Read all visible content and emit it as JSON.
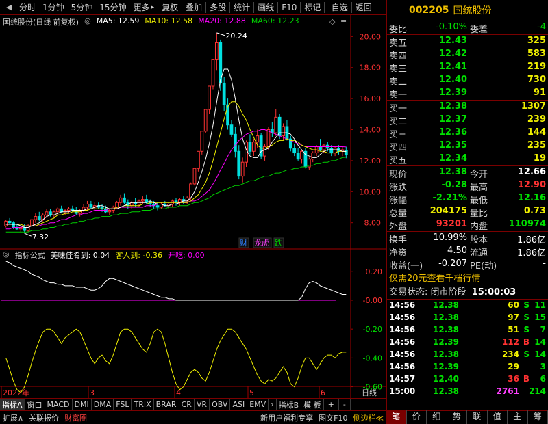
{
  "colors": {
    "up": "#ff3232",
    "down": "#00e0e0",
    "green": "#00d000",
    "white": "#ffffff",
    "ma5": "#ffffff",
    "ma10": "#f0f000",
    "ma20": "#ff00ff",
    "ma60": "#00cc00",
    "axis": "#a00000",
    "gold": "#f0c000"
  },
  "toolbar": {
    "items": [
      "分时",
      "1分钟",
      "5分钟",
      "15分钟",
      "更多",
      "复权",
      "叠加",
      "多股",
      "统计",
      "画线",
      "F10",
      "标记",
      "-自选",
      "返回"
    ],
    "more_arrow": "▸"
  },
  "chart": {
    "stock_label": "国统股份(日线 前复权)",
    "ma_toggle": "◎",
    "ma": [
      {
        "label": "MA5: 12.59",
        "color": "#ffffff"
      },
      {
        "label": "MA10: 12.58",
        "color": "#f0f000"
      },
      {
        "label": "MA20: 12.88",
        "color": "#ff00ff"
      },
      {
        "label": "MA60: 12.23",
        "color": "#00cc00"
      }
    ],
    "price_axis": [
      "20.00",
      "18.00",
      "16.00",
      "14.00",
      "12.00",
      "10.00",
      "8.00"
    ],
    "price_range": [
      6.4,
      20.5
    ],
    "high_label": "20.24",
    "low_label": "7.32",
    "markers": [
      {
        "text": "财",
        "color": "#3080ff"
      },
      {
        "text": "龙虎",
        "color": "#ff40ff"
      },
      {
        "text": "跌",
        "color": "#00d000"
      }
    ],
    "icons": [
      "diamond-icon",
      "menu-icon"
    ]
  },
  "indicator": {
    "name": "指标公式",
    "values": [
      {
        "label": "美味佳肴到: 0.04",
        "color": "#ffffff"
      },
      {
        "label": "客人到: -0.36",
        "color": "#f0f000"
      },
      {
        "label": "开吃: 0.00",
        "color": "#ff00ff"
      }
    ],
    "axis": [
      "0.20",
      "-0.00",
      "-0.20",
      "-0.40",
      "-0.60"
    ],
    "range": [
      -0.64,
      0.27
    ]
  },
  "x_axis": {
    "labels": [
      "2022年",
      "3",
      "4",
      "5",
      "6"
    ],
    "corner": "日线"
  },
  "indicator_tabs": [
    "指标A",
    "窗口",
    "MACD",
    "DMI",
    "DMA",
    "FSL",
    "TRIX",
    "BRAR",
    "CR",
    "VR",
    "OBV",
    "ASI",
    "EMV",
    "指标B",
    "模 板",
    "+",
    "-"
  ],
  "nav_arrow": "›",
  "status_bar": [
    {
      "text": "扩展∧",
      "color": "#d0d0d0"
    },
    {
      "text": "关联报价",
      "color": "#d0d0d0"
    },
    {
      "text": "财富圈",
      "color": "#ff4040"
    }
  ],
  "status_right": [
    {
      "text": "新用户福利专享",
      "color": "#d0d0d0"
    },
    {
      "text": "图文F10",
      "color": "#d0d0d0"
    },
    {
      "text": "侧边栏≪",
      "color": "#f0c000"
    }
  ],
  "quote": {
    "code": "002205",
    "name": "国统股份",
    "weibi_label": "委比",
    "weibi_value": "-0.10%",
    "weicha_label": "委差",
    "weicha_value": "-4",
    "asks": [
      {
        "label": "卖五",
        "price": "12.43",
        "vol": "325"
      },
      {
        "label": "卖四",
        "price": "12.42",
        "vol": "583"
      },
      {
        "label": "卖三",
        "price": "12.41",
        "vol": "219"
      },
      {
        "label": "卖二",
        "price": "12.40",
        "vol": "730"
      },
      {
        "label": "卖一",
        "price": "12.39",
        "vol": "91"
      }
    ],
    "bids": [
      {
        "label": "买一",
        "price": "12.38",
        "vol": "1307"
      },
      {
        "label": "买二",
        "price": "12.37",
        "vol": "239"
      },
      {
        "label": "买三",
        "price": "12.36",
        "vol": "144"
      },
      {
        "label": "买四",
        "price": "12.35",
        "vol": "235"
      },
      {
        "label": "买五",
        "price": "12.34",
        "vol": "19"
      }
    ],
    "stats": [
      {
        "l1": "现价",
        "v1": "12.38",
        "c1": "#00e000",
        "l2": "今开",
        "v2": "12.66",
        "c2": "#ffffff"
      },
      {
        "l1": "涨跌",
        "v1": "-0.28",
        "c1": "#00e000",
        "l2": "最高",
        "v2": "12.90",
        "c2": "#ff3232"
      },
      {
        "l1": "涨幅",
        "v1": "-2.21%",
        "c1": "#00e000",
        "l2": "最低",
        "v2": "12.16",
        "c2": "#00e000"
      },
      {
        "l1": "总量",
        "v1": "204175",
        "c1": "#f0f000",
        "l2": "量比",
        "v2": "0.73",
        "c2": "#f0f000"
      },
      {
        "l1": "外盘",
        "v1": "93201",
        "c1": "#ff3232",
        "l2": "内盘",
        "v2": "110974",
        "c2": "#00e000"
      }
    ],
    "stats2": [
      {
        "l1": "换手",
        "v1": "10.99%",
        "l2": "股本",
        "v2": "1.86亿"
      },
      {
        "l1": "净资",
        "v1": "4.50",
        "l2": "流通",
        "v2": "1.86亿"
      },
      {
        "l1": "收益(一)",
        "v1": "-0.207",
        "l2": "PE(动)",
        "v2": "-"
      }
    ],
    "promo": "仅需20元查看千档行情",
    "trade_state_label": "交易状态: 闭市阶段",
    "trade_state_time": "15:00:03",
    "ticks": [
      {
        "time": "14:56",
        "price": "12.38",
        "vol": "60",
        "side": "S",
        "n": "11"
      },
      {
        "time": "14:56",
        "price": "12.38",
        "vol": "97",
        "side": "S",
        "n": "15"
      },
      {
        "time": "14:56",
        "price": "12.38",
        "vol": "51",
        "side": "S",
        "n": "7"
      },
      {
        "time": "14:56",
        "price": "12.39",
        "vol": "112",
        "side": "B",
        "n": "14"
      },
      {
        "time": "14:56",
        "price": "12.38",
        "vol": "234",
        "side": "S",
        "n": "14"
      },
      {
        "time": "14:56",
        "price": "12.39",
        "vol": "29",
        "side": "",
        "n": "3"
      },
      {
        "time": "14:57",
        "price": "12.40",
        "vol": "36",
        "side": "B",
        "n": "6"
      },
      {
        "time": "15:00",
        "price": "12.38",
        "vol": "2761",
        "side": "",
        "n": "214"
      }
    ],
    "right_tabs": [
      "笔",
      "价",
      "细",
      "势",
      "联",
      "值",
      "主",
      "筹"
    ]
  },
  "chart_data": {
    "type": "candlestick",
    "candles": [
      [
        7.8,
        8.2,
        7.7,
        8.1
      ],
      [
        8.1,
        8.3,
        7.9,
        8.0
      ],
      [
        8.0,
        8.1,
        7.6,
        7.7
      ],
      [
        7.7,
        7.9,
        7.5,
        7.6
      ],
      [
        7.6,
        7.8,
        7.4,
        7.7
      ],
      [
        7.7,
        7.9,
        7.32,
        7.5
      ],
      [
        7.5,
        7.9,
        7.4,
        7.8
      ],
      [
        7.8,
        8.3,
        7.7,
        8.2
      ],
      [
        8.2,
        8.6,
        8.0,
        8.4
      ],
      [
        8.4,
        8.7,
        8.1,
        8.2
      ],
      [
        8.2,
        8.6,
        8.1,
        8.5
      ],
      [
        8.5,
        8.9,
        8.3,
        8.7
      ],
      [
        8.7,
        8.9,
        8.4,
        8.5
      ],
      [
        8.5,
        8.8,
        8.3,
        8.7
      ],
      [
        8.7,
        9.0,
        8.5,
        8.9
      ],
      [
        8.9,
        9.1,
        8.6,
        8.7
      ],
      [
        8.7,
        8.9,
        8.5,
        8.8
      ],
      [
        8.8,
        9.0,
        8.6,
        8.9
      ],
      [
        8.9,
        9.1,
        8.7,
        8.8
      ],
      [
        8.8,
        9.0,
        8.5,
        8.6
      ],
      [
        8.6,
        8.9,
        8.4,
        8.8
      ],
      [
        8.8,
        9.2,
        8.7,
        9.0
      ],
      [
        9.0,
        9.4,
        8.8,
        9.2
      ],
      [
        9.2,
        9.4,
        8.9,
        9.0
      ],
      [
        9.0,
        9.3,
        8.8,
        9.1
      ],
      [
        9.1,
        9.3,
        8.9,
        9.0
      ],
      [
        9.0,
        9.2,
        8.7,
        8.9
      ],
      [
        8.9,
        9.1,
        8.6,
        8.7
      ],
      [
        8.7,
        8.9,
        8.5,
        8.8
      ],
      [
        8.8,
        9.1,
        8.6,
        9.0
      ],
      [
        9.0,
        9.4,
        8.9,
        9.3
      ],
      [
        9.3,
        9.8,
        9.1,
        9.6
      ],
      [
        9.6,
        9.9,
        9.2,
        9.3
      ],
      [
        9.3,
        9.5,
        8.9,
        9.1
      ],
      [
        9.1,
        9.4,
        8.9,
        9.3
      ],
      [
        9.3,
        9.6,
        9.0,
        9.2
      ],
      [
        9.2,
        9.5,
        9.0,
        9.4
      ],
      [
        9.4,
        9.7,
        9.2,
        9.5
      ],
      [
        9.5,
        9.8,
        9.2,
        9.3
      ],
      [
        9.3,
        9.5,
        9.0,
        9.2
      ],
      [
        9.2,
        9.4,
        8.9,
        9.1
      ],
      [
        9.1,
        9.3,
        8.8,
        9.0
      ],
      [
        9.0,
        9.3,
        8.9,
        9.2
      ],
      [
        9.2,
        9.4,
        9.0,
        9.1
      ],
      [
        9.1,
        9.3,
        8.9,
        9.2
      ],
      [
        9.2,
        9.5,
        9.0,
        9.4
      ],
      [
        9.4,
        9.6,
        9.1,
        9.3
      ],
      [
        9.3,
        9.6,
        9.1,
        9.5
      ],
      [
        9.5,
        9.7,
        9.2,
        9.4
      ],
      [
        9.4,
        9.7,
        9.2,
        9.6
      ],
      [
        9.6,
        10.6,
        9.5,
        10.5
      ],
      [
        10.5,
        11.5,
        10.4,
        11.5
      ],
      [
        11.5,
        12.6,
        11.3,
        12.6
      ],
      [
        12.6,
        13.9,
        12.4,
        13.9
      ],
      [
        13.9,
        15.3,
        13.8,
        15.3
      ],
      [
        15.3,
        16.8,
        15.0,
        16.8
      ],
      [
        16.8,
        18.5,
        16.6,
        18.5
      ],
      [
        18.5,
        20.24,
        17.8,
        19.6
      ],
      [
        19.6,
        19.8,
        16.5,
        17.0
      ],
      [
        17.0,
        17.4,
        15.2,
        15.6
      ],
      [
        15.6,
        16.0,
        14.0,
        14.3
      ],
      [
        14.3,
        14.6,
        13.5,
        13.7
      ],
      [
        13.7,
        14.2,
        12.2,
        12.6
      ],
      [
        12.6,
        13.0,
        10.8,
        11.0
      ],
      [
        11.0,
        12.2,
        10.6,
        11.9
      ],
      [
        11.9,
        13.3,
        11.6,
        13.2
      ],
      [
        13.2,
        13.7,
        12.4,
        12.6
      ],
      [
        12.6,
        13.4,
        12.3,
        13.2
      ],
      [
        13.2,
        14.0,
        12.8,
        13.6
      ],
      [
        13.6,
        13.8,
        12.1,
        12.3
      ],
      [
        12.3,
        13.1,
        12.0,
        12.9
      ],
      [
        12.9,
        14.2,
        12.7,
        14.0
      ],
      [
        14.0,
        14.5,
        13.5,
        13.8
      ],
      [
        13.8,
        15.3,
        13.6,
        14.8
      ],
      [
        14.8,
        15.0,
        13.4,
        13.6
      ],
      [
        13.6,
        14.4,
        13.3,
        14.2
      ],
      [
        14.2,
        14.6,
        13.3,
        13.4
      ],
      [
        13.4,
        13.6,
        12.6,
        12.8
      ],
      [
        12.8,
        13.1,
        12.3,
        12.5
      ],
      [
        12.5,
        12.8,
        12.0,
        12.1
      ],
      [
        12.1,
        12.7,
        11.8,
        12.6
      ],
      [
        12.6,
        12.8,
        11.5,
        11.6
      ],
      [
        11.6,
        12.2,
        11.4,
        12.1
      ],
      [
        12.1,
        12.6,
        11.9,
        12.5
      ],
      [
        12.5,
        13.0,
        12.3,
        12.9
      ],
      [
        12.9,
        13.4,
        12.6,
        12.7
      ],
      [
        12.7,
        13.1,
        12.5,
        13.0
      ],
      [
        13.0,
        13.2,
        12.6,
        12.8
      ],
      [
        12.8,
        13.0,
        12.3,
        12.5
      ],
      [
        12.5,
        12.9,
        12.3,
        12.8
      ],
      [
        12.8,
        13.0,
        12.4,
        12.6
      ],
      [
        12.6,
        12.9,
        12.3,
        12.7
      ],
      [
        12.66,
        12.9,
        12.16,
        12.38
      ]
    ],
    "ma5": [
      7.9,
      7.9,
      7.9,
      7.9,
      7.8,
      7.7,
      7.7,
      7.8,
      7.9,
      8.0,
      8.2,
      8.4,
      8.5,
      8.5,
      8.6,
      8.7,
      8.7,
      8.7,
      8.8,
      8.8,
      8.8,
      8.8,
      8.9,
      8.9,
      9.0,
      9.1,
      9.1,
      9.0,
      8.9,
      8.9,
      8.9,
      9.0,
      9.1,
      9.2,
      9.3,
      9.3,
      9.3,
      9.3,
      9.3,
      9.4,
      9.3,
      9.2,
      9.2,
      9.1,
      9.1,
      9.2,
      9.2,
      9.3,
      9.4,
      9.4,
      9.6,
      10.0,
      10.6,
      11.3,
      12.1,
      13.1,
      14.3,
      15.8,
      17.2,
      17.9,
      17.9,
      17.2,
      16.0,
      14.6,
      13.4,
      12.7,
      12.3,
      12.2,
      12.2,
      12.6,
      12.7,
      12.8,
      13.2,
      13.5,
      13.8,
      13.8,
      13.8,
      13.7,
      13.4,
      13.0,
      12.7,
      12.4,
      12.3,
      12.2,
      12.2,
      12.4,
      12.6,
      12.7,
      12.7,
      12.7,
      12.7,
      12.6,
      12.59
    ],
    "ma10": [
      7.9,
      7.9,
      7.9,
      7.9,
      7.9,
      7.8,
      7.8,
      7.8,
      7.8,
      7.9,
      8.0,
      8.1,
      8.2,
      8.3,
      8.5,
      8.5,
      8.6,
      8.6,
      8.7,
      8.7,
      8.7,
      8.8,
      8.8,
      8.9,
      8.9,
      8.9,
      8.9,
      8.9,
      8.9,
      8.9,
      9.0,
      9.0,
      9.1,
      9.1,
      9.1,
      9.1,
      9.1,
      9.2,
      9.2,
      9.3,
      9.3,
      9.3,
      9.3,
      9.3,
      9.3,
      9.3,
      9.3,
      9.3,
      9.3,
      9.3,
      9.4,
      9.6,
      9.8,
      10.2,
      10.6,
      11.2,
      12.0,
      12.9,
      13.8,
      14.7,
      15.5,
      15.8,
      15.8,
      15.5,
      15.0,
      14.6,
      14.0,
      13.5,
      13.0,
      12.8,
      12.8,
      12.9,
      13.0,
      13.2,
      13.3,
      13.3,
      13.4,
      13.3,
      13.3,
      13.2,
      13.0,
      12.9,
      12.8,
      12.7,
      12.7,
      12.6,
      12.6,
      12.5,
      12.5,
      12.5,
      12.6,
      12.6,
      12.58
    ],
    "ma20": [
      7.6,
      7.6,
      7.7,
      7.7,
      7.7,
      7.8,
      7.8,
      7.8,
      7.8,
      7.8,
      7.9,
      7.9,
      8.0,
      8.0,
      8.1,
      8.2,
      8.2,
      8.3,
      8.4,
      8.5,
      8.5,
      8.6,
      8.6,
      8.7,
      8.8,
      8.8,
      8.8,
      8.8,
      8.9,
      8.9,
      8.9,
      9.0,
      9.0,
      9.0,
      9.0,
      9.0,
      9.0,
      9.0,
      9.1,
      9.1,
      9.1,
      9.2,
      9.2,
      9.2,
      9.2,
      9.2,
      9.2,
      9.3,
      9.3,
      9.3,
      9.4,
      9.4,
      9.5,
      9.7,
      9.9,
      10.1,
      10.5,
      10.9,
      11.4,
      11.8,
      12.3,
      12.7,
      13.0,
      13.3,
      13.5,
      13.7,
      13.8,
      13.9,
      13.9,
      14.0,
      14.0,
      13.9,
      13.8,
      13.7,
      13.6,
      13.5,
      13.4,
      13.3,
      13.2,
      13.1,
      13.0,
      12.9,
      12.9,
      12.9,
      12.9,
      12.9,
      12.9,
      12.9,
      12.9,
      12.9,
      12.9,
      12.9,
      12.88
    ],
    "ma60": [
      7.4,
      7.4,
      7.4,
      7.4,
      7.4,
      7.4,
      7.4,
      7.5,
      7.5,
      7.5,
      7.6,
      7.6,
      7.7,
      7.7,
      7.8,
      7.8,
      7.9,
      7.9,
      8.0,
      8.0,
      8.1,
      8.1,
      8.2,
      8.2,
      8.3,
      8.3,
      8.4,
      8.4,
      8.4,
      8.5,
      8.5,
      8.6,
      8.6,
      8.6,
      8.7,
      8.7,
      8.7,
      8.8,
      8.8,
      8.8,
      8.9,
      8.9,
      8.9,
      8.9,
      9.0,
      9.0,
      9.0,
      9.1,
      9.1,
      9.1,
      9.2,
      9.3,
      9.3,
      9.4,
      9.5,
      9.6,
      9.8,
      9.9,
      10.0,
      10.1,
      10.2,
      10.3,
      10.4,
      10.4,
      10.5,
      10.6,
      10.7,
      10.7,
      10.8,
      10.9,
      11.0,
      11.0,
      11.1,
      11.2,
      11.2,
      11.3,
      11.4,
      11.4,
      11.5,
      11.5,
      11.6,
      11.6,
      11.7,
      11.7,
      11.8,
      11.8,
      11.9,
      11.9,
      12.0,
      12.0,
      12.1,
      12.2,
      12.23
    ],
    "ind_white": [
      0.27,
      0.26,
      0.24,
      0.23,
      0.22,
      0.21,
      0.2,
      0.18,
      0.17,
      0.16,
      0.14,
      0.13,
      0.12,
      0.12,
      0.11,
      0.11,
      0.1,
      0.1,
      0.1,
      0.09,
      0.09,
      0.09,
      0.08,
      0.07,
      0.07,
      0.08,
      0.1,
      0.13,
      0.15,
      0.15,
      0.14,
      0.13,
      0.12,
      0.11,
      0.1,
      0.09,
      0.08,
      0.07,
      0.06,
      0.05,
      0.04,
      0.03,
      0.02,
      0.02,
      0.01,
      0.01,
      0.0,
      0.0,
      0.0,
      0.0,
      0.0,
      0.0,
      0.0,
      0.0,
      0.0,
      0.0,
      0.0,
      0.0,
      0.0,
      0.0,
      0.0,
      0.0,
      0.0,
      0.0,
      0.0,
      0.0,
      0.0,
      0.0,
      0.0,
      0.0,
      0.0,
      0.0,
      0.0,
      0.0,
      0.0,
      0.0,
      0.0,
      0.0,
      0.0,
      0.0,
      0.02,
      0.08,
      0.12,
      0.13,
      0.12,
      0.1,
      0.09,
      0.08,
      0.07,
      0.06,
      0.05,
      0.04,
      0.04
    ],
    "ind_yellow": [
      -0.4,
      -0.48,
      -0.56,
      -0.62,
      -0.64,
      -0.6,
      -0.52,
      -0.43,
      -0.35,
      -0.28,
      -0.22,
      -0.2,
      -0.2,
      -0.22,
      -0.26,
      -0.3,
      -0.26,
      -0.24,
      -0.22,
      -0.2,
      -0.22,
      -0.28,
      -0.34,
      -0.4,
      -0.44,
      -0.4,
      -0.38,
      -0.42,
      -0.44,
      -0.38,
      -0.3,
      -0.22,
      -0.2,
      -0.2,
      -0.22,
      -0.26,
      -0.3,
      -0.34,
      -0.36,
      -0.3,
      -0.22,
      -0.2,
      -0.22,
      -0.3,
      -0.4,
      -0.5,
      -0.58,
      -0.62,
      -0.6,
      -0.55,
      -0.5,
      -0.48,
      -0.5,
      -0.54,
      -0.56,
      -0.5,
      -0.42,
      -0.34,
      -0.28,
      -0.24,
      -0.2,
      -0.2,
      -0.22,
      -0.26,
      -0.3,
      -0.34,
      -0.4,
      -0.46,
      -0.52,
      -0.56,
      -0.58,
      -0.55,
      -0.56,
      -0.54,
      -0.5,
      -0.46,
      -0.5,
      -0.58,
      -0.6,
      -0.54,
      -0.46,
      -0.4,
      -0.4,
      -0.44,
      -0.48,
      -0.44,
      -0.4,
      -0.38,
      -0.38,
      -0.4,
      -0.37,
      -0.36,
      -0.36
    ],
    "ind_magenta": 0.0
  }
}
